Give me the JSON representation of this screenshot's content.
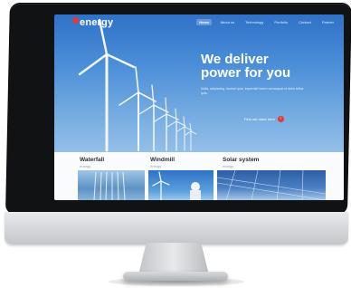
{
  "site": {
    "logo_text": "energy",
    "nav": [
      {
        "label": "Home",
        "active": true
      },
      {
        "label": "About us",
        "active": false
      },
      {
        "label": "Technology",
        "active": false
      },
      {
        "label": "Portfolio",
        "active": false
      },
      {
        "label": "Contact",
        "active": false
      },
      {
        "label": "Partner",
        "active": false
      }
    ],
    "hero": {
      "title_line1": "We deliver",
      "title_line2": "power for you",
      "body": "Nulla, adipiscing, laoreet quis, imperdiet lorem consequat et dolor tellus quis.",
      "cta_label": "Find out more here",
      "cta_icon": "arrow-right"
    },
    "cards": [
      {
        "title": "Waterfall",
        "subtitle": "energy"
      },
      {
        "title": "Windmill",
        "subtitle": "energy"
      },
      {
        "title": "Solar system",
        "subtitle": "energy"
      }
    ]
  },
  "colors": {
    "accent": "#e53935",
    "sky_top": "#2f72c8",
    "sky_bottom": "#b9d6ef",
    "bezel": "#101214",
    "chin": "#d7d9dc"
  }
}
